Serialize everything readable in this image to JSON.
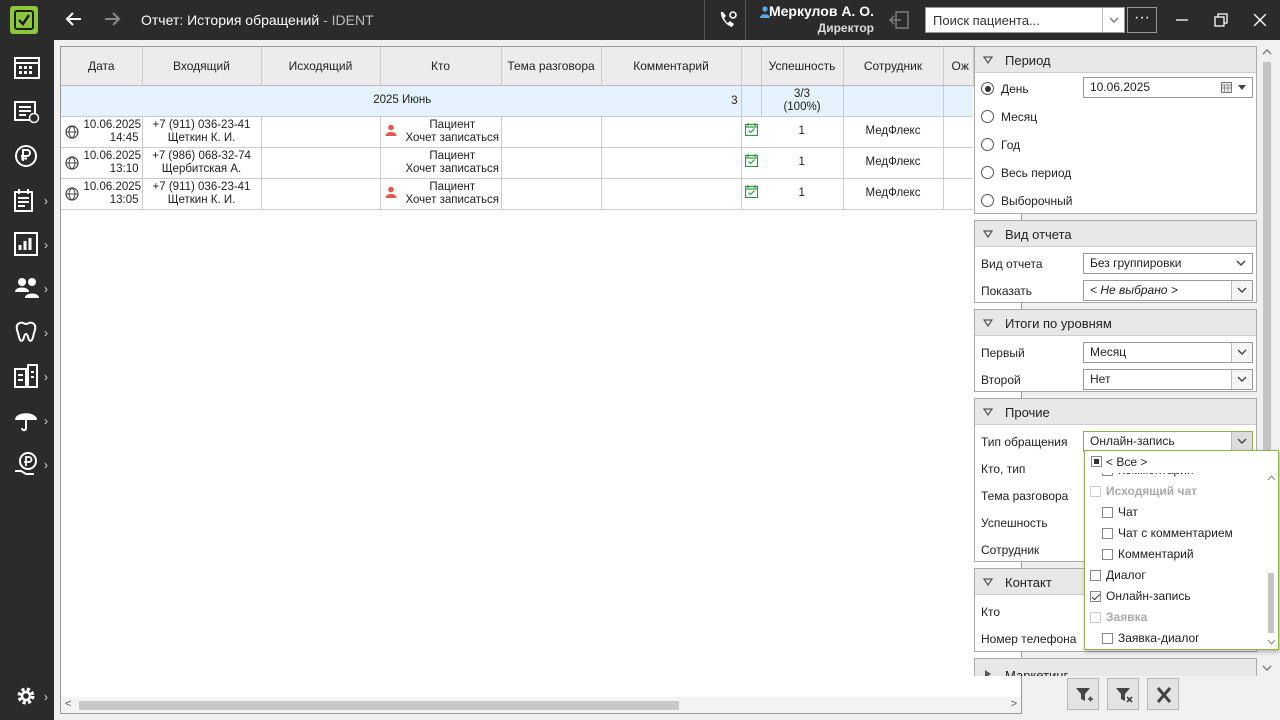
{
  "window": {
    "title": "Отчет: История обращений",
    "app_suffix": " - IDENT",
    "user_name": "Меркулов А. О.",
    "user_role": "Директор",
    "patient_search_placeholder": "Поиск пациента...",
    "more": "···"
  },
  "grid": {
    "columns": [
      "Дата",
      "Входящий",
      "Исходящий",
      "Кто",
      "Тема разговора",
      "Комментарий",
      "",
      "Успешность",
      "Сотрудник",
      "Ож"
    ],
    "group": {
      "label": "2025 Июнь",
      "count": "3",
      "success_line1": "3/3",
      "success_line2": "(100%)"
    },
    "rows": [
      {
        "date": "10.06.2025",
        "time": "14:45",
        "phone": "+7 (911) 036-23-41",
        "name": "Щеткин К. И.",
        "who_type": "Пациент",
        "who_note": "Хочет записаться",
        "person_icon": true,
        "success": "1",
        "employee": "МедФлекс"
      },
      {
        "date": "10.06.2025",
        "time": "13:10",
        "phone": "+7 (986) 068-32-74",
        "name": "Щербитская А.",
        "who_type": "Пациент",
        "who_note": "Хочет записаться",
        "person_icon": false,
        "success": "1",
        "employee": "МедФлекс"
      },
      {
        "date": "10.06.2025",
        "time": "13:05",
        "phone": "+7 (911) 036-23-41",
        "name": "Щеткин К. И.",
        "who_type": "Пациент",
        "who_note": "Хочет записаться",
        "person_icon": true,
        "success": "1",
        "employee": "МедФлекс"
      }
    ]
  },
  "filters": {
    "period": {
      "title": "Период",
      "options": [
        "День",
        "Месяц",
        "Год",
        "Весь период",
        "Выборочный"
      ],
      "selected": "День",
      "date_value": "10.06.2025"
    },
    "report_view": {
      "title": "Вид отчета",
      "view_label": "Вид отчета",
      "view_value": "Без группировки",
      "show_label": "Показать",
      "show_value": "< Не выбрано >"
    },
    "levels": {
      "title": "Итоги по уровням",
      "first_label": "Первый",
      "first_value": "Месяц",
      "second_label": "Второй",
      "second_value": "Нет"
    },
    "other": {
      "title": "Прочие",
      "type_label": "Тип обращения",
      "type_value": "Онлайн-запись",
      "who_label": "Кто, тип",
      "topic_label": "Тема разговора",
      "success_label": "Успешность",
      "employee_label": "Сотрудник"
    },
    "contact": {
      "title": "Контакт",
      "who_label": "Кто",
      "phone_label": "Номер телефона"
    },
    "marketing": {
      "title": "Маркетинг"
    }
  },
  "dropdown": {
    "all_label": "< Все >",
    "items": [
      {
        "label": "Комментарий",
        "indent": true,
        "state": "unchecked",
        "disabled": false
      },
      {
        "label": "Исходящий чат",
        "indent": false,
        "state": "unchecked",
        "disabled": true
      },
      {
        "label": "Чат",
        "indent": true,
        "state": "unchecked",
        "disabled": false
      },
      {
        "label": "Чат с комментарием",
        "indent": true,
        "state": "unchecked",
        "disabled": false
      },
      {
        "label": "Комментарий",
        "indent": true,
        "state": "unchecked",
        "disabled": false
      },
      {
        "label": "Диалог",
        "indent": false,
        "state": "unchecked",
        "disabled": false
      },
      {
        "label": "Онлайн-запись",
        "indent": false,
        "state": "checked",
        "disabled": false
      },
      {
        "label": "Заявка",
        "indent": false,
        "state": "unchecked",
        "disabled": true
      },
      {
        "label": "Заявка-диалог",
        "indent": true,
        "state": "unchecked",
        "disabled": false
      }
    ]
  },
  "colors": {
    "accent": "#8cc63f",
    "group_row": "#e3f2fb",
    "person_icon": "#e05a4e",
    "calendar_icon": "#2e9a3e"
  }
}
